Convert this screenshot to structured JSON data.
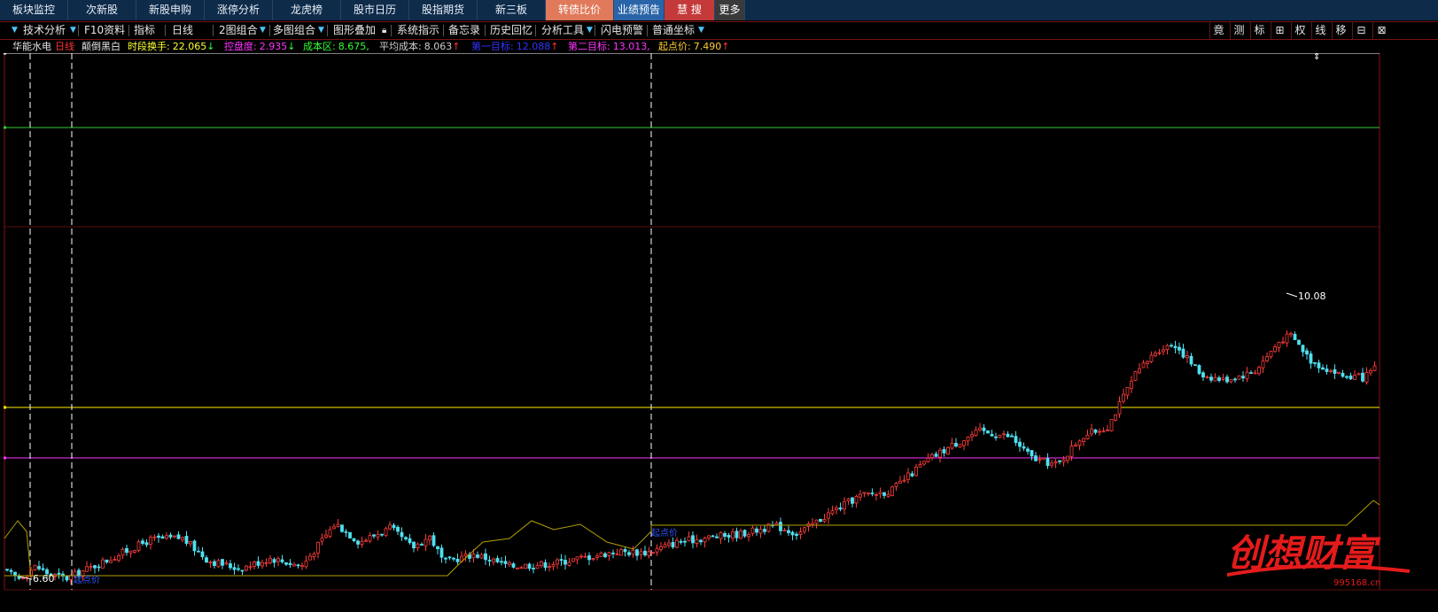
{
  "topnav": {
    "tabs": [
      {
        "label": "板块监控",
        "w": 77
      },
      {
        "label": "次新股",
        "w": 77
      },
      {
        "label": "新股申购",
        "w": 77
      },
      {
        "label": "涨停分析",
        "w": 77
      },
      {
        "label": "龙虎榜",
        "w": 77
      },
      {
        "label": "股市日历",
        "w": 77
      },
      {
        "label": "股指期货",
        "w": 77
      },
      {
        "label": "新三板",
        "w": 77
      },
      {
        "label": "转债比价",
        "w": 77,
        "style": "hl-orange"
      },
      {
        "label": "业绩预告",
        "w": 57,
        "style": "hl-blue"
      },
      {
        "label": "慧  搜",
        "w": 57,
        "style": "hl-red"
      },
      {
        "label": "更多",
        "w": 34,
        "style": "hl-gray"
      }
    ]
  },
  "toolbar": {
    "items": [
      "技术分析",
      "F10资料",
      "指标",
      "日线",
      "2图组合",
      "多图组合",
      "图形叠加",
      "系统指示",
      "备忘录",
      "历史回忆",
      "分析工具",
      "闪电预警",
      "普通坐标"
    ],
    "right_items": [
      "竟",
      "测",
      "标",
      "⊞",
      "权",
      "线",
      "移",
      "⊟",
      "⊠"
    ]
  },
  "infobar": {
    "stock_name": "华能水电",
    "period": "日线",
    "mode": "颠倒黑白",
    "indicators": [
      {
        "label": "时段换手:",
        "value": "22.065",
        "arrow": "↓",
        "color": "#ffff33",
        "arrow_color": "#33ff33"
      },
      {
        "label": "控盘度:",
        "value": "2.935",
        "arrow": "↓",
        "color": "#ff33ff",
        "arrow_color": "#33ff33"
      },
      {
        "label": "成本区:",
        "value": "8.675,",
        "arrow": "",
        "color": "#33ff33",
        "arrow_color": "#33ff33"
      },
      {
        "label": "平均成本:",
        "value": "8.063",
        "arrow": "↑",
        "color": "#cccccc",
        "arrow_color": "#ff3333"
      },
      {
        "label": "第一目标:",
        "value": "12.088",
        "arrow": "↑",
        "color": "#3333ff",
        "arrow_color": "#ff3333"
      },
      {
        "label": "第二目标:",
        "value": "13.013,",
        "arrow": "",
        "color": "#ff33ff",
        "arrow_color": "#ff3333"
      },
      {
        "label": "起点价:",
        "value": "7.490",
        "arrow": "↑",
        "color": "#ffcc33",
        "arrow_color": "#ff3333"
      }
    ]
  },
  "chart": {
    "high_label": "10.08",
    "low_label": "6.60",
    "start_label_1": "起点价",
    "start_label_2": "起点价",
    "colors": {
      "up": "#ff3b3b",
      "down": "#4fe0f0",
      "ma": "#b3a000",
      "cost": "#8a7a00",
      "line_white": "#ffffff",
      "line_green": "#33cc33",
      "line_yellow": "#ffee00",
      "line_magenta": "#ff33ff",
      "grid": "#5a0e0e"
    }
  },
  "watermark": {
    "brand": "创想财富",
    "url": "995168.cn"
  }
}
